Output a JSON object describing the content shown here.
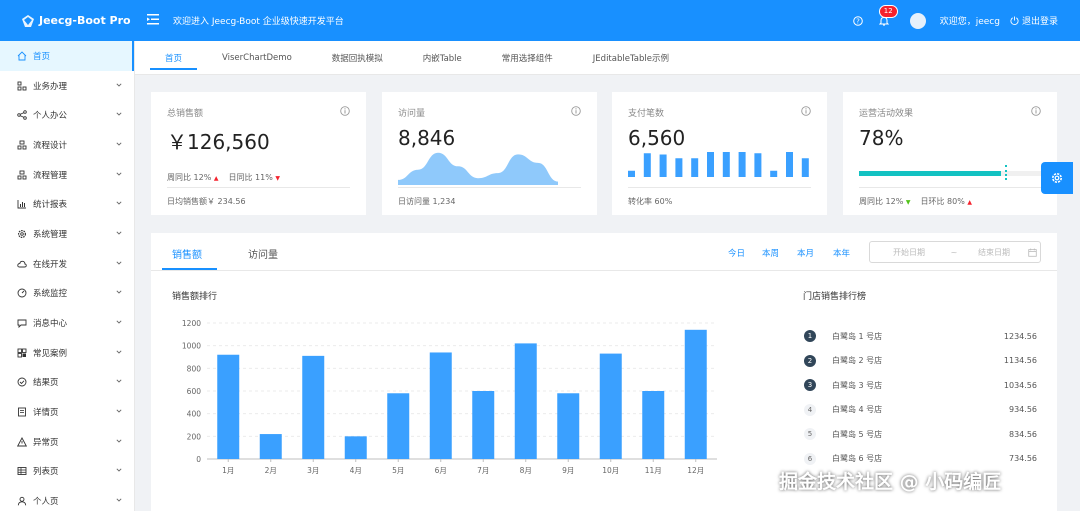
{
  "header": {
    "app_title": "Jeecg-Boot Pro",
    "welcome": "欢迎进入 Jeecg-Boot 企业级快速开发平台",
    "notice_count": "12",
    "user_greeting": "欢迎您，jeecg",
    "logout_label": "退出登录",
    "background_color": "#1890ff"
  },
  "sidebar": {
    "items": [
      {
        "label": "首页",
        "icon": "home-icon"
      },
      {
        "label": "业务办理",
        "icon": "cluster-icon"
      },
      {
        "label": "个人办公",
        "icon": "share-icon"
      },
      {
        "label": "流程设计",
        "icon": "flow-icon"
      },
      {
        "label": "流程管理",
        "icon": "flow-manage-icon"
      },
      {
        "label": "统计报表",
        "icon": "bar-chart-icon"
      },
      {
        "label": "系统管理",
        "icon": "settings-icon"
      },
      {
        "label": "在线开发",
        "icon": "cloud-icon"
      },
      {
        "label": "系统监控",
        "icon": "dashboard-icon"
      },
      {
        "label": "消息中心",
        "icon": "message-icon"
      },
      {
        "label": "常见案例",
        "icon": "case-icon"
      },
      {
        "label": "结果页",
        "icon": "check-circle-icon"
      },
      {
        "label": "详情页",
        "icon": "profile-icon"
      },
      {
        "label": "异常页",
        "icon": "warning-icon"
      },
      {
        "label": "列表页",
        "icon": "table-icon"
      },
      {
        "label": "个人页",
        "icon": "user-icon"
      }
    ]
  },
  "tabs": [
    "首页",
    "ViserChartDemo",
    "数据回执模拟",
    "内嵌Table",
    "常用选择组件",
    "JEditableTable示例"
  ],
  "cards": {
    "sales": {
      "title": "总销售额",
      "value": "￥126,560",
      "week_label": "周同比",
      "week_value": "12%",
      "day_label": "日同比",
      "day_value": "11%",
      "footer": "日均销售额￥ 234.56"
    },
    "visits": {
      "title": "访问量",
      "value": "8,846",
      "footer": "日访问量 1,234"
    },
    "payments": {
      "title": "支付笔数",
      "value": "6,560",
      "footer": "转化率 60%"
    },
    "operations": {
      "title": "运营活动效果",
      "value": "78%",
      "progress": 0.78,
      "week_label": "周同比",
      "week_value": "12%",
      "day_label": "日环比",
      "day_value": "80%"
    }
  },
  "main": {
    "tab_sales": "销售额",
    "tab_visits": "访问量",
    "ranges": [
      "今日",
      "本周",
      "本月",
      "本年"
    ],
    "date_start_placeholder": "开始日期",
    "date_separator": "~",
    "date_end_placeholder": "结束日期",
    "chart_title": "销售额排行",
    "rank_title": "门店销售排行榜",
    "rank_items": [
      {
        "rank": "1",
        "name": "白鹭岛 1 号店",
        "value": "1234.56"
      },
      {
        "rank": "2",
        "name": "白鹭岛 2 号店",
        "value": "1134.56"
      },
      {
        "rank": "3",
        "name": "白鹭岛 3 号店",
        "value": "1034.56"
      },
      {
        "rank": "4",
        "name": "白鹭岛 4 号店",
        "value": "934.56"
      },
      {
        "rank": "5",
        "name": "白鹭岛 5 号店",
        "value": "834.56"
      },
      {
        "rank": "6",
        "name": "白鹭岛 6 号店",
        "value": "734.56"
      }
    ]
  },
  "visits_area": [
    0.15,
    0.45,
    0.95,
    0.55,
    0.2,
    0.35,
    0.9,
    0.65,
    0.1
  ],
  "payments_bars": [
    0.25,
    0.95,
    0.9,
    0.75,
    0.75,
    1.0,
    1.0,
    1.0,
    0.95,
    0.25,
    1.0,
    0.75
  ],
  "chart_data": {
    "type": "bar",
    "categories": [
      "1月",
      "2月",
      "3月",
      "4月",
      "5月",
      "6月",
      "7月",
      "8月",
      "9月",
      "10月",
      "11月",
      "12月"
    ],
    "values": [
      920,
      220,
      910,
      200,
      580,
      940,
      600,
      1020,
      580,
      930,
      600,
      1140
    ],
    "ylim": [
      0,
      1200
    ],
    "yticks": [
      0,
      200,
      400,
      600,
      800,
      1000,
      1200
    ],
    "color": "#3aa0ff",
    "grid": true
  },
  "watermark": "掘金技术社区 @ 小码编匠"
}
